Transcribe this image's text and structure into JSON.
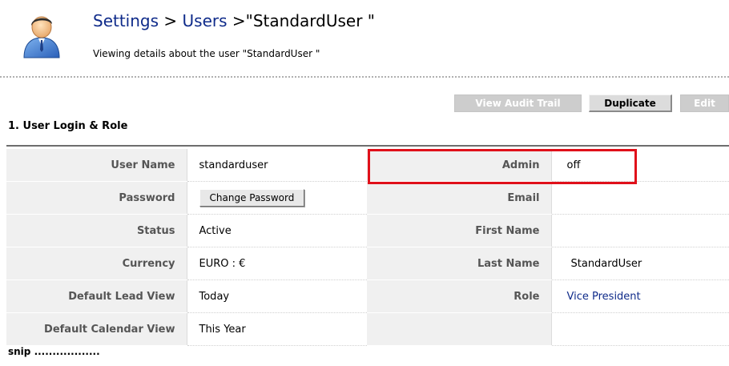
{
  "header": {
    "breadcrumb": {
      "settings": "Settings",
      "separator_1": " > ",
      "users": "Users",
      "separator_2": " >",
      "current": "\"StandardUser \""
    },
    "subtitle": "Viewing details about the user \"StandardUser \"",
    "avatar_icon": "user-avatar-icon"
  },
  "toolbar": {
    "view_audit_trail": "View Audit Trail",
    "duplicate": "Duplicate",
    "edit": "Edit"
  },
  "section": {
    "title": "1. User Login & Role",
    "rows": [
      {
        "left_label": "User Name",
        "left_value": "standarduser",
        "right_label": "Admin",
        "right_value": "off"
      },
      {
        "left_label": "Password",
        "left_button": "Change Password",
        "right_label": "Email",
        "right_value": ""
      },
      {
        "left_label": "Status",
        "left_value": "Active",
        "right_label": "First Name",
        "right_value": ""
      },
      {
        "left_label": "Currency",
        "left_value": "EURO : €",
        "right_label": "Last Name",
        "right_value": "StandardUser"
      },
      {
        "left_label": "Default Lead View",
        "left_value": "Today",
        "right_label": "Role",
        "right_value": "Vice President"
      },
      {
        "left_label": "Default Calendar View",
        "left_value": "This Year",
        "right_label": "",
        "right_value": ""
      }
    ]
  },
  "footer": {
    "snip": "snip .................."
  },
  "colors": {
    "link": "#0f2b8a",
    "label_bg": "#f0f0f0",
    "disabled_button_bg": "#cdcdcd",
    "highlight": "#e0101a",
    "section_rule": "#6e6e6e"
  }
}
